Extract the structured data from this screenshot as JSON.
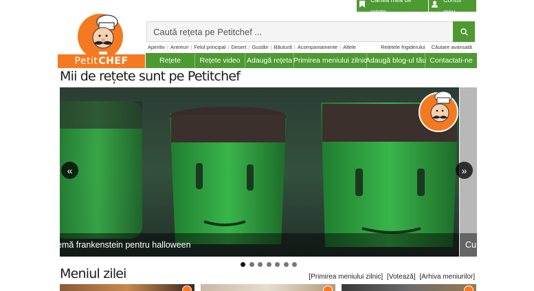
{
  "topbar": {
    "recipe_book": "Cartea mea de rețete",
    "account": "Contul meu"
  },
  "logo": {
    "text_light": "Petit",
    "text_bold": "CHEF"
  },
  "search": {
    "placeholder": "Caută rețeta pe Petitchef ..."
  },
  "sublinks": [
    "Aperitiv",
    "Antreuri",
    "Felul principal",
    "Desert",
    "Gustări",
    "Băutură",
    "Acompaniamente",
    "Altele"
  ],
  "sublinks_right": [
    "Rețetele frigiderului",
    "Căutare avansată"
  ],
  "nav": [
    "Rețete",
    "Rețete video",
    "Adaugă rețeta",
    "Primirea meniului zilnic",
    "Adaugă blog-ul tău",
    "Contactati-ne"
  ],
  "headline": "Mii de rețete sunt pe Petitchef",
  "slider": {
    "caption": "emă frankenstein pentru halloween",
    "next_caption": "Cu",
    "dots": 7,
    "active_dot": 0
  },
  "menu": {
    "title": "Meniul zilei",
    "links": [
      "[Primirea meniului zilnic]",
      "[Votează]",
      "[Arhiva meniurilor]"
    ]
  },
  "colors": {
    "green": "#4d9a32",
    "orange": "#f47920"
  },
  "icons": [
    "bookmark-icon",
    "user-icon",
    "search-icon",
    "chevron-left-icon",
    "chevron-right-icon"
  ]
}
